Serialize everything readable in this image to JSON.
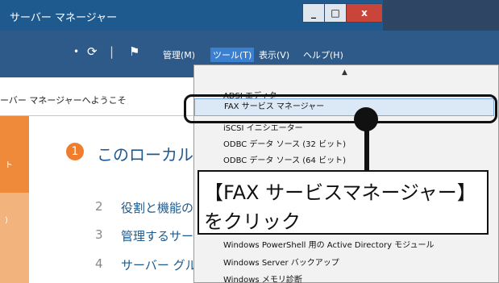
{
  "window": {
    "title": "サーバー マネージャー",
    "buttons": [
      "_",
      "□",
      "x"
    ]
  },
  "toolbar": {
    "dropdown_glyph": "•",
    "refresh_glyph": "⟳",
    "separator": "|",
    "flag_glyph": "⚑",
    "menus": [
      "管理(M)",
      "ツール(T)",
      "表示(V)",
      "ヘルプ(H)"
    ],
    "selected_menu": "ツール(T)"
  },
  "welcome": "ーバー マネージャーへようこそ",
  "left_panel": {
    "label1": "ト",
    "label2": ")"
  },
  "steps": [
    {
      "num": "1",
      "label": "このローカル サ"
    },
    {
      "num": "2",
      "label": "役割と機能の"
    },
    {
      "num": "3",
      "label": "管理するサー"
    },
    {
      "num": "4",
      "label": "サーバー グル"
    }
  ],
  "menu": {
    "scroll_up": "▲",
    "items": [
      "ADSI エディター",
      "FAX サービス マネージャー",
      "iSCSI イニシエーター",
      "ODBC データ ソース (32 ビット)",
      "ODBC データ ソース (64 ビット)",
      "Windows PowerShell 用の Active Directory モジュール",
      "Windows Server バックアップ",
      "Windows メモリ診断"
    ],
    "highlighted": "FAX サービス マネージャー"
  },
  "callout": {
    "line1": "【FAX サービスマネージャー】",
    "line2": "をクリック"
  },
  "colors": {
    "titlebar": "#1f5a8f",
    "toolbar": "#2d5a88",
    "accent_orange": "#ef7d2c",
    "menu_highlight": "#dbe8f6"
  }
}
